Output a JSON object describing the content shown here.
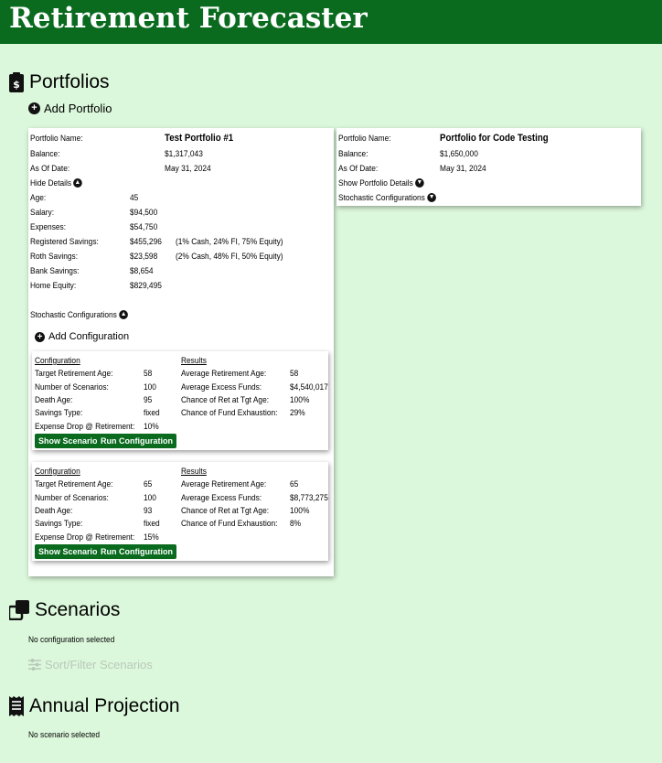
{
  "app": {
    "title": "Retirement Forecaster"
  },
  "portfolios_section": {
    "title": "Portfolios",
    "add_label": "Add Portfolio"
  },
  "portfolio1": {
    "name_label": "Portfolio Name:",
    "name": "Test Portfolio #1",
    "balance_label": "Balance:",
    "balance": "$1,317,043",
    "date_label": "As Of Date:",
    "date": "May 31, 2024",
    "toggle_label": "Hide Details",
    "age_label": "Age:",
    "age": "45",
    "salary_label": "Salary:",
    "salary": "$94,500",
    "expenses_label": "Expenses:",
    "expenses": "$54,750",
    "reg_label": "Registered Savings:",
    "reg": "$455,296",
    "reg_alloc": "(1% Cash, 24% FI, 75% Equity)",
    "roth_label": "Roth Savings:",
    "roth": "$23,598",
    "roth_alloc": "(2% Cash, 48% FI, 50% Equity)",
    "bank_label": "Bank Savings:",
    "bank": "$8,654",
    "home_label": "Home Equity:",
    "home": "$829,495",
    "stoch_label": "Stochastic Configurations",
    "add_config_label": "Add Configuration",
    "configs": [
      {
        "cfg_head": "Configuration",
        "res_head": "Results",
        "tra_label": "Target Retirement Age:",
        "tra": "58",
        "nos_label": "Number of Scenarios:",
        "nos": "100",
        "da_label": "Death Age:",
        "da": "95",
        "st_label": "Savings Type:",
        "st": "fixed",
        "ed_label": "Expense Drop @ Retirement:",
        "ed": "10%",
        "ara_label": "Average Retirement Age:",
        "ara": "58",
        "aef_label": "Average Excess Funds:",
        "aef": "$4,540,017",
        "crt_label": "Chance of Ret at Tgt Age:",
        "crt": "100%",
        "cfe_label": "Chance of Fund Exhaustion:",
        "cfe": "29%",
        "show_label": "Show Scenarios",
        "run_label": "Run Configuration"
      },
      {
        "cfg_head": "Configuration",
        "res_head": "Results",
        "tra_label": "Target Retirement Age:",
        "tra": "65",
        "nos_label": "Number of Scenarios:",
        "nos": "100",
        "da_label": "Death Age:",
        "da": "93",
        "st_label": "Savings Type:",
        "st": "fixed",
        "ed_label": "Expense Drop @ Retirement:",
        "ed": "15%",
        "ara_label": "Average Retirement Age:",
        "ara": "65",
        "aef_label": "Average Excess Funds:",
        "aef": "$8,773,275",
        "crt_label": "Chance of Ret at Tgt Age:",
        "crt": "100%",
        "cfe_label": "Chance of Fund Exhaustion:",
        "cfe": "8%",
        "show_label": "Show Scenarios",
        "run_label": "Run Configuration"
      }
    ]
  },
  "portfolio2": {
    "name_label": "Portfolio Name:",
    "name": "Portfolio for Code Testing",
    "balance_label": "Balance:",
    "balance": "$1,650,000",
    "date_label": "As Of Date:",
    "date": "May 31, 2024",
    "toggle_label": "Show Portfolio Details",
    "stoch_label": "Stochastic Configurations"
  },
  "scenarios_section": {
    "title": "Scenarios",
    "empty": "No configuration selected",
    "sort_label": "Sort/Filter Scenarios"
  },
  "projection_section": {
    "title": "Annual Projection",
    "empty": "No scenario selected"
  },
  "colors": {
    "header": "#0a6b1f",
    "background": "#dcf8dc",
    "button": "#0a6b1f"
  }
}
